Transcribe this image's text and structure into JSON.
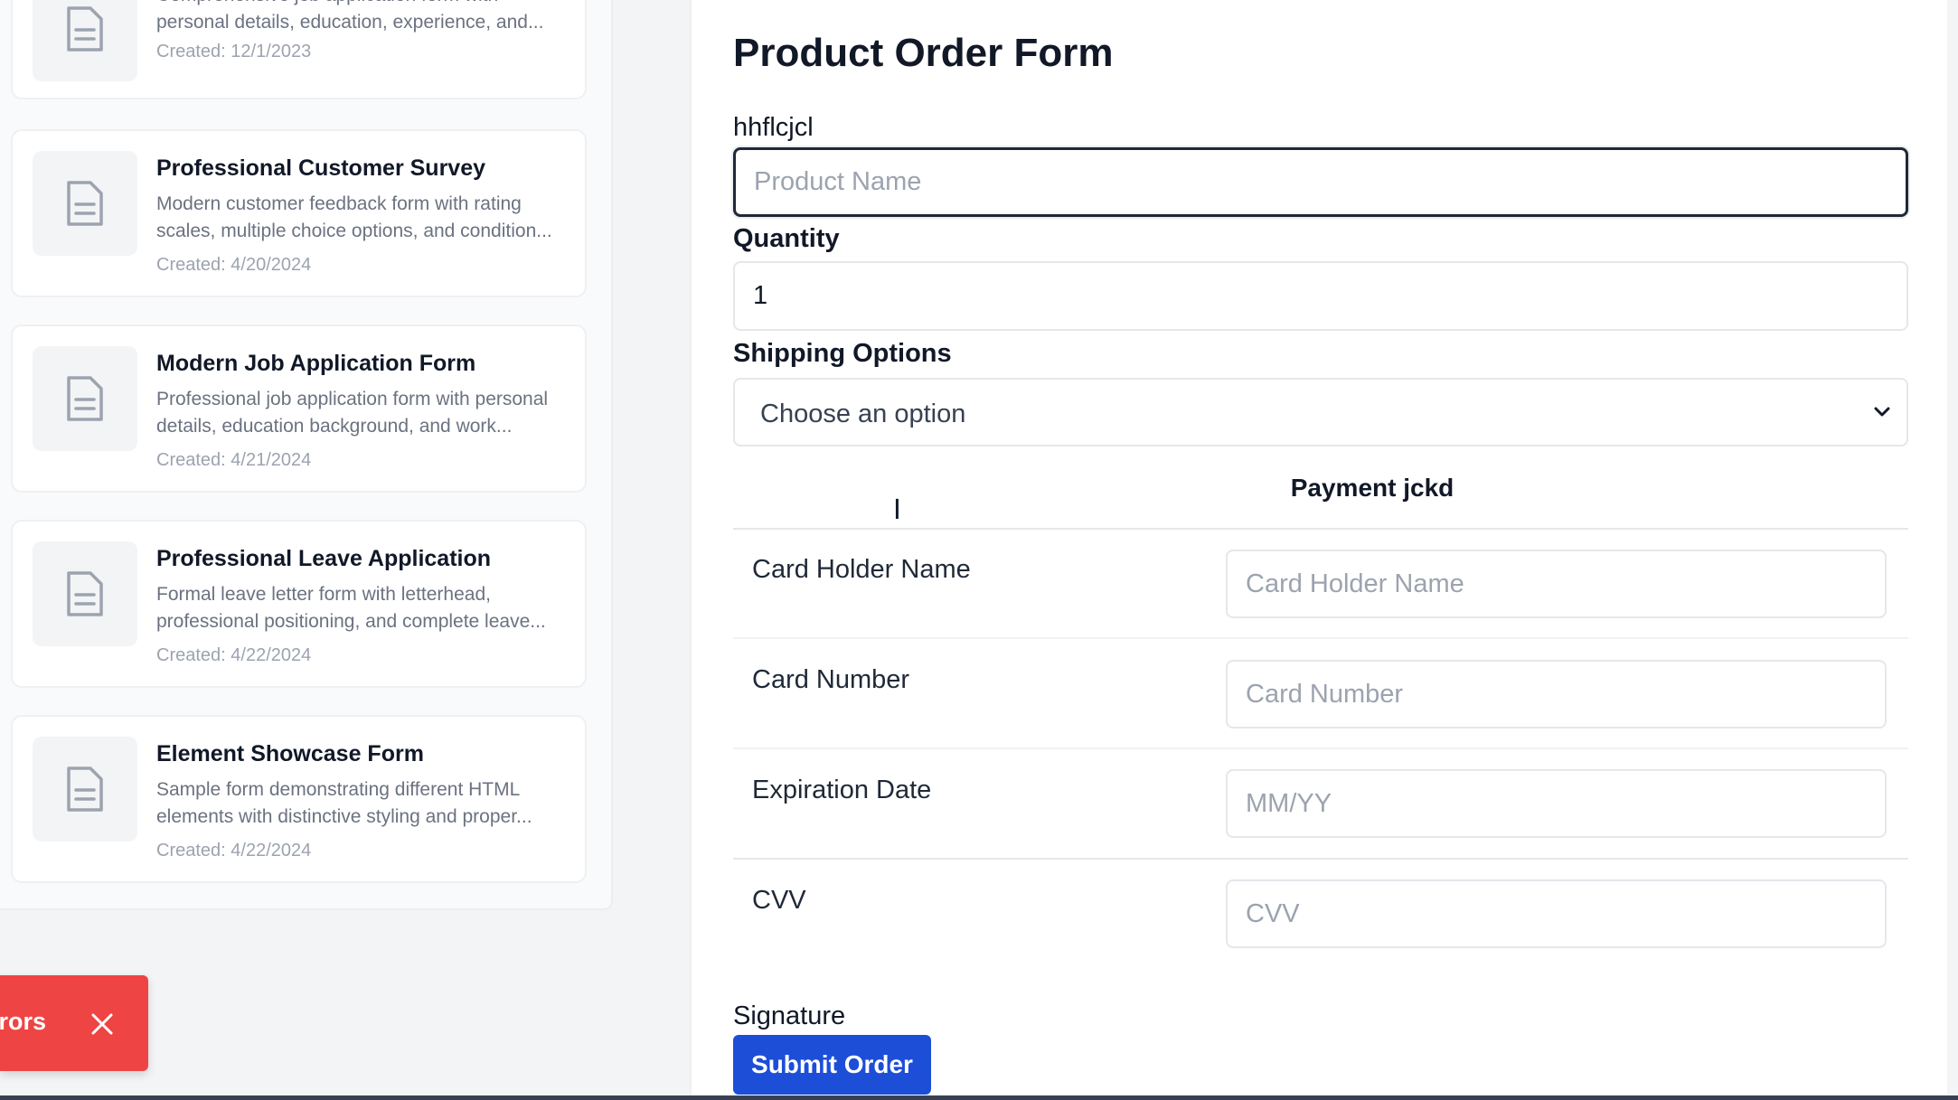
{
  "form_list": [
    {
      "title": "",
      "description_line1": "Comprehensive job application form with",
      "description_line2": "personal details, education, experience, and...",
      "created": "Created: 12/1/2023",
      "icon": "document-icon"
    },
    {
      "title": "Professional Customer Survey",
      "description_line1": "Modern customer feedback form with rating",
      "description_line2": "scales, multiple choice options, and condition...",
      "created": "Created: 4/20/2024",
      "icon": "document-icon"
    },
    {
      "title": "Modern Job Application Form",
      "description_line1": "Professional job application form with personal",
      "description_line2": "details, education background, and work...",
      "created": "Created: 4/21/2024",
      "icon": "document-icon"
    },
    {
      "title": "Professional Leave Application",
      "description_line1": "Formal leave letter form with letterhead,",
      "description_line2": "professional positioning, and complete leave...",
      "created": "Created: 4/22/2024",
      "icon": "document-icon"
    },
    {
      "title": "Element Showcase Form",
      "description_line1": "Sample form demonstrating different HTML",
      "description_line2": "elements with distinctive styling and proper...",
      "created": "Created: 4/22/2024",
      "icon": "document-icon"
    }
  ],
  "toast": {
    "text": "rors",
    "color": "#ef4444"
  },
  "form": {
    "title": "Product Order Form",
    "product_label": "hhflcjcl",
    "product_placeholder": "Product Name",
    "quantity_label": "Quantity",
    "quantity_value": "1",
    "shipping_label": "Shipping Options",
    "shipping_selected": "Choose an option",
    "payment_title": "Payment jckd",
    "payment_fields": [
      {
        "label": "Card Holder Name",
        "placeholder": "Card Holder Name"
      },
      {
        "label": "Card Number",
        "placeholder": "Card Number"
      },
      {
        "label": "Expiration Date",
        "placeholder": "MM/YY"
      },
      {
        "label": "CVV",
        "placeholder": "CVV"
      }
    ],
    "signature_label": "Signature",
    "submit_label": "Submit Order",
    "submit_color": "#1d4ed8"
  }
}
